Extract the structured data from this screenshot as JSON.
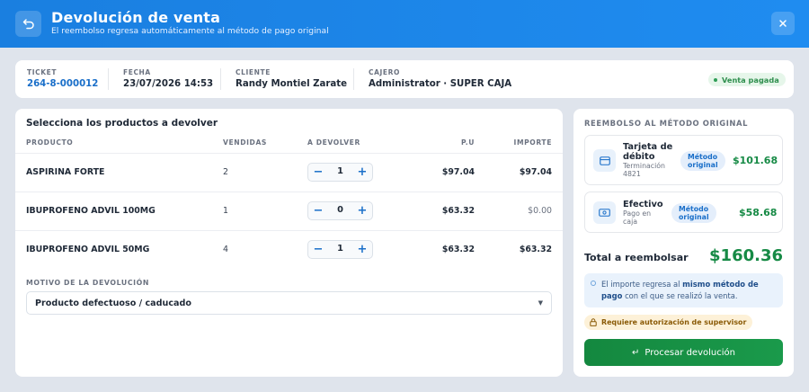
{
  "header": {
    "title": "Devolución de venta",
    "subtitle": "El reembolso regresa automáticamente al método de pago original"
  },
  "info": {
    "ticket_label": "TICKET",
    "ticket_value": "264-8-000012",
    "fecha_label": "FECHA",
    "fecha_value": "23/07/2026 14:53",
    "cliente_label": "CLIENTE",
    "cliente_value": "Randy Montiel Zarate",
    "cajero_label": "CAJERO",
    "cajero_value": "Administrator · SUPER CAJA",
    "status_badge": "Venta pagada"
  },
  "products": {
    "title": "Selecciona los productos a devolver",
    "columns": [
      "PRODUCTO",
      "VENDIDAS",
      "A DEVOLVER",
      "P.U",
      "IMPORTE"
    ],
    "rows": [
      {
        "name": "ASPIRINA FORTE",
        "sold": "2",
        "qty": "1",
        "price": "$97.04",
        "amount": "$97.04"
      },
      {
        "name": "IBUPROFENO ADVIL 100MG",
        "sold": "1",
        "qty": "0",
        "price": "$63.32",
        "amount": "$0.00"
      },
      {
        "name": "IBUPROFENO ADVIL 50MG",
        "sold": "4",
        "qty": "1",
        "price": "$63.32",
        "amount": "$63.32"
      }
    ],
    "minus_glyph": "−",
    "plus_glyph": "+"
  },
  "reason": {
    "label": "MOTIVO DE LA DEVOLUCIÓN",
    "selected": "Producto defectuoso / caducado"
  },
  "refund": {
    "title": "REEMBOLSO AL MÉTODO ORIGINAL",
    "methods": [
      {
        "name_l1": "Tarjeta de",
        "name_l2": "débito",
        "sub_l1": "Terminación",
        "sub_l2": "4821",
        "badge_l1": "Método",
        "badge_l2": "original",
        "amount": "$101.68",
        "icon": "credit-card-icon"
      },
      {
        "name_l1": "Efectivo",
        "sub_l1": "Pago en",
        "sub_l2": "caja",
        "badge_l1": "Método",
        "badge_l2": "original",
        "amount": "$58.68",
        "icon": "cash-icon"
      }
    ],
    "total_label": "Total a reembolsar",
    "total_value": "$160.36",
    "note_pre": "El importe regresa al ",
    "note_bold": "mismo método de pago",
    "note_post": " con el que se realizó la venta.",
    "warning": "Requiere autorización de supervisor",
    "process_button": "Procesar devolución"
  },
  "colors": {
    "header_blue": "#1f8cf0",
    "accent_green": "#168a45",
    "link_blue": "#1a6fc9"
  }
}
